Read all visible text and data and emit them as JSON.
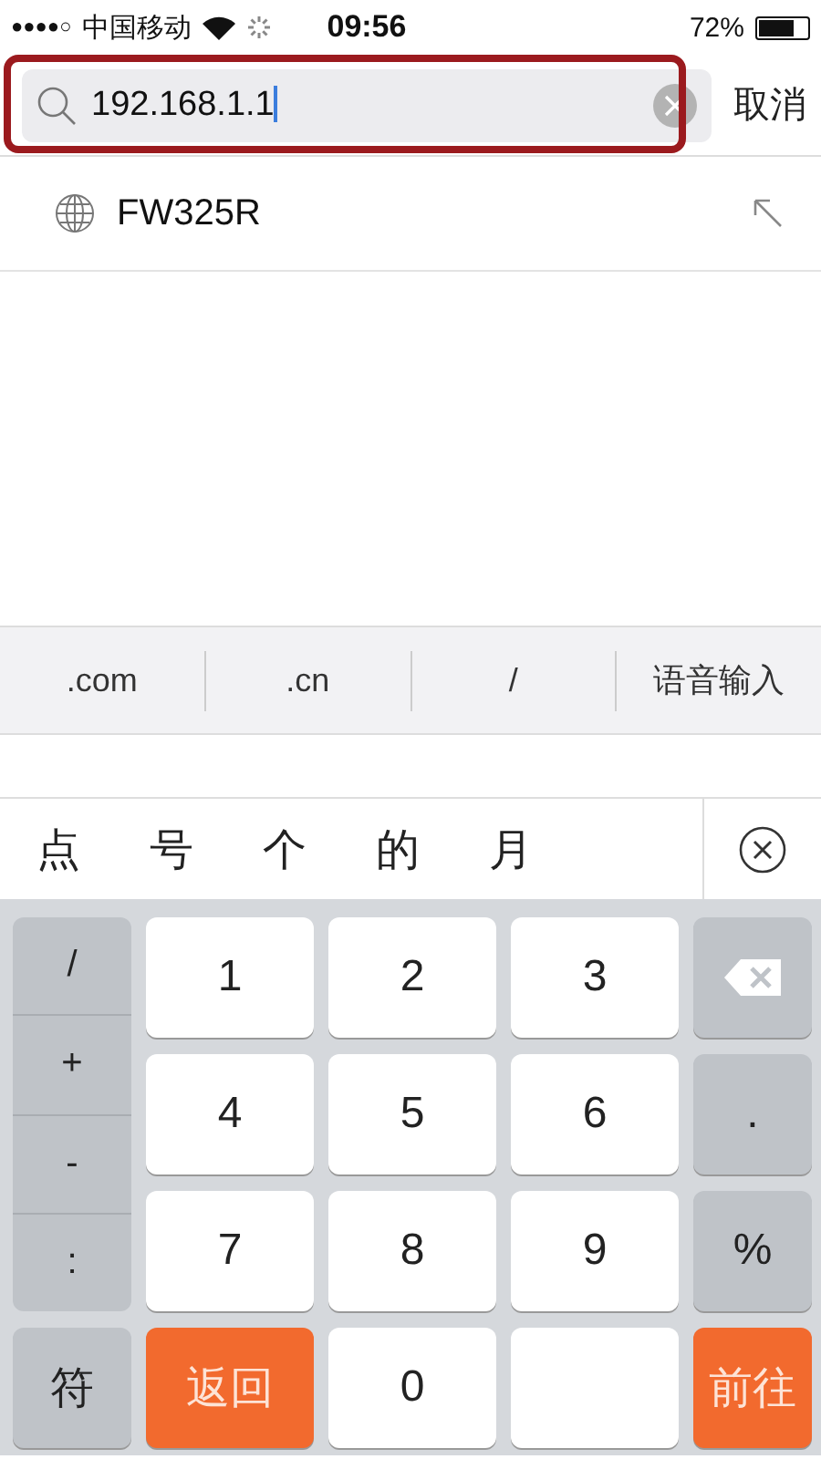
{
  "status_bar": {
    "signal_dots": "●●●●○",
    "carrier": "中国移动",
    "time": "09:56",
    "battery_text": "72%",
    "battery": {
      "level": 0.72
    }
  },
  "search": {
    "value": "192.168.1.1",
    "cancel": "取消",
    "highlighted": true
  },
  "suggestions": [
    {
      "label": "FW325R"
    }
  ],
  "shortcuts": [
    ".com",
    ".cn",
    "/",
    "语音输入"
  ],
  "candidates": [
    "点",
    "号",
    "个",
    "的",
    "月"
  ],
  "keyboard": {
    "symbols": [
      "/",
      "+",
      "-",
      ":"
    ],
    "keys": [
      {
        "label": "1",
        "kind": "digit"
      },
      {
        "label": "2",
        "kind": "digit"
      },
      {
        "label": "3",
        "kind": "digit"
      },
      {
        "kind": "delete"
      },
      {
        "label": "4",
        "kind": "digit"
      },
      {
        "label": "5",
        "kind": "digit"
      },
      {
        "label": "6",
        "kind": "digit"
      },
      {
        "label": ".",
        "kind": "function"
      },
      {
        "label": "7",
        "kind": "digit"
      },
      {
        "label": "8",
        "kind": "digit"
      },
      {
        "label": "9",
        "kind": "digit"
      },
      {
        "label": "%",
        "kind": "function"
      }
    ],
    "bottom": [
      {
        "label": "符",
        "kind": "function"
      },
      {
        "label": "返回",
        "kind": "action"
      },
      {
        "label": "0",
        "kind": "digit"
      },
      {
        "kind": "space"
      },
      {
        "label": "前往",
        "kind": "action"
      }
    ]
  }
}
